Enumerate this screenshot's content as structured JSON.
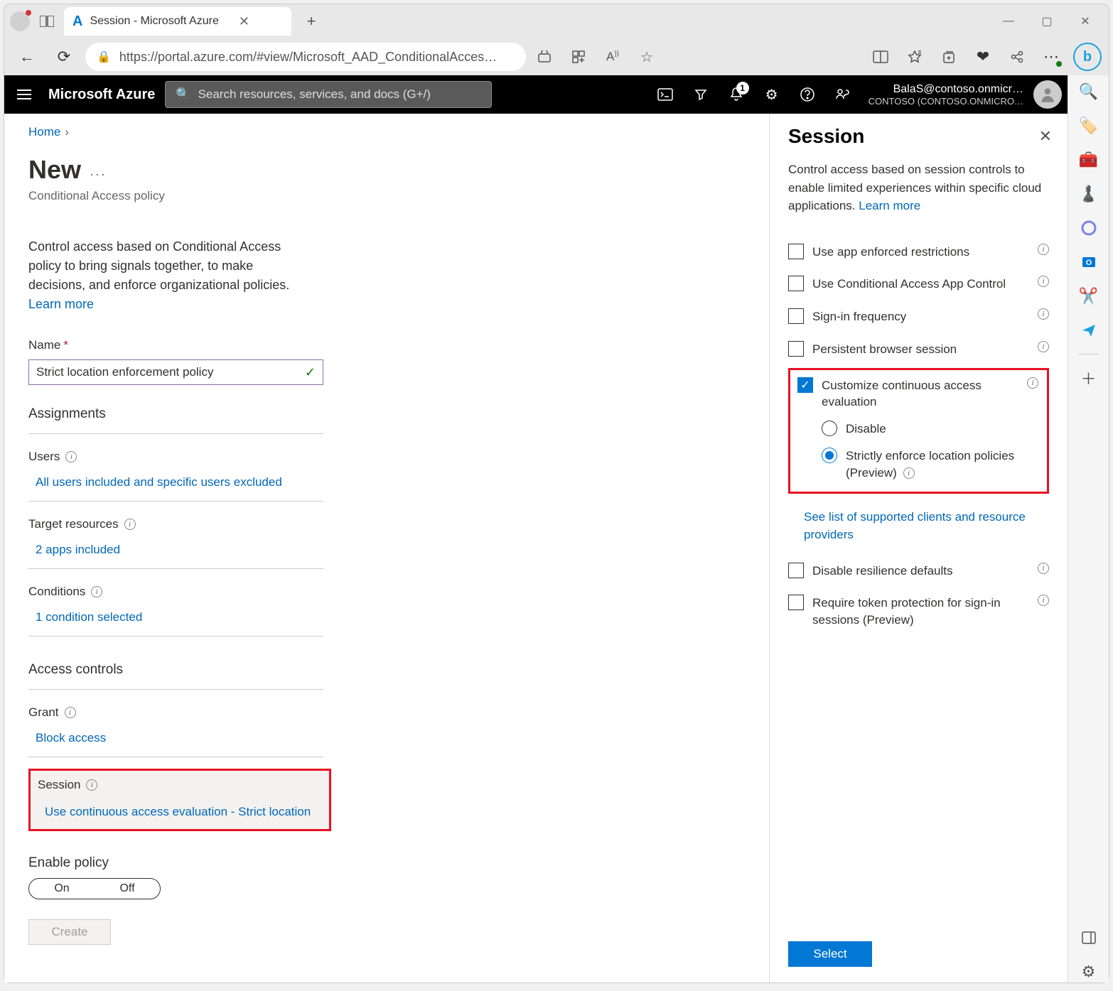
{
  "browser": {
    "tab_title": "Session - Microsoft Azure",
    "url": "https://portal.azure.com/#view/Microsoft_AAD_ConditionalAcces…"
  },
  "portal_header": {
    "brand": "Microsoft Azure",
    "search_placeholder": "Search resources, services, and docs (G+/)",
    "notification_count": "1",
    "account_name": "BalaS@contoso.onmicr…",
    "account_tenant": "CONTOSO (CONTOSO.ONMICRO…"
  },
  "breadcrumb": {
    "home": "Home"
  },
  "blade": {
    "title": "New",
    "subtitle": "Conditional Access policy",
    "intro": "Control access based on Conditional Access policy to bring signals together, to make decisions, and enforce organizational policies.",
    "learn_more": "Learn more",
    "name_label": "Name",
    "name_value": "Strict location enforcement policy",
    "assignments_heading": "Assignments",
    "users_label": "Users",
    "users_value": "All users included and specific users excluded",
    "target_label": "Target resources",
    "target_value": "2 apps included",
    "conditions_label": "Conditions",
    "conditions_value": "1 condition selected",
    "access_controls_heading": "Access controls",
    "grant_label": "Grant",
    "grant_value": "Block access",
    "session_label": "Session",
    "session_value": "Use continuous access evaluation - Strict location",
    "enable_label": "Enable policy",
    "toggle_on": "On",
    "toggle_off": "Off",
    "create": "Create"
  },
  "panel": {
    "title": "Session",
    "desc": "Control access based on session controls to enable limited experiences within specific cloud applications.",
    "learn_more": "Learn more",
    "opt_app_enforced": "Use app enforced restrictions",
    "opt_app_control": "Use Conditional Access App Control",
    "opt_signin_freq": "Sign-in frequency",
    "opt_persistent": "Persistent browser session",
    "opt_cae": "Customize continuous access evaluation",
    "radio_disable": "Disable",
    "radio_strict": "Strictly enforce location policies (Preview)",
    "link_supported": "See list of supported clients and resource providers",
    "opt_resilience": "Disable resilience defaults",
    "opt_token": "Require token protection for sign-in sessions (Preview)",
    "select": "Select"
  }
}
